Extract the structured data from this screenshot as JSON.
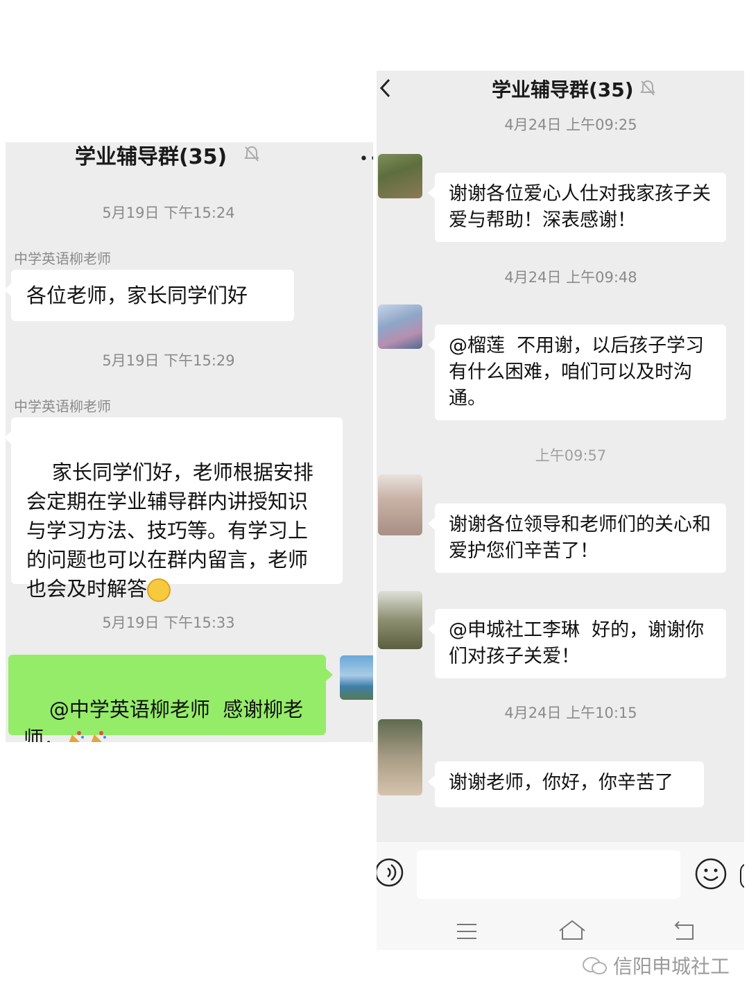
{
  "left": {
    "title": "学业辅导群(35)",
    "more_icon": "more-icon",
    "messages": [
      {
        "timestamp": "5月19日 下午15:24",
        "sender": "中学英语柳老师",
        "text": "各位老师，家长同学们好"
      },
      {
        "timestamp": "5月19日 下午15:29",
        "sender": "中学英语柳老师",
        "text": "家长同学们好，老师根据安排会定期在学业辅导群内讲授知识与学习方法、技巧等。有学习上的问题也可以在群内留言，老师也会及时解答"
      },
      {
        "timestamp": "5月19日 下午15:33",
        "text": "@中学英语柳老师  感谢柳老师，"
      }
    ]
  },
  "right": {
    "title": "学业辅导群(35)",
    "back_icon": "back-arrow-icon",
    "messages": [
      {
        "timestamp": "4月24日 上午09:25",
        "text": "谢谢各位爱心人仕对我家孩子关爱与帮助！深表感谢！"
      },
      {
        "timestamp": "4月24日 上午09:48",
        "text": "@榴莲  不用谢，以后孩子学习有什么困难，咱们可以及时沟通。"
      },
      {
        "timestamp": "上午09:57",
        "text": "谢谢各位领导和老师们的关心和爱护您们辛苦了！"
      },
      {
        "text": "@申城社工李琳  好的，谢谢你们对孩子关爱！"
      },
      {
        "timestamp": "4月24日 上午10:15",
        "text": "谢谢老师，你好，你辛苦了"
      }
    ],
    "input_placeholder": "",
    "nav": {
      "menu_icon": "menu-icon",
      "home_icon": "home-icon",
      "back_icon": "return-icon"
    }
  },
  "watermark": "信阳申城社工",
  "colors": {
    "chat_bg": "#ededed",
    "bubble_in": "#ffffff",
    "bubble_out": "#95ec69",
    "timestamp": "#8a8a8a"
  }
}
